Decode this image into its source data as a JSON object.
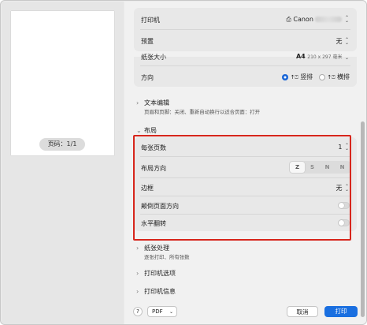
{
  "preview": {
    "page_badge": "页码：1/1"
  },
  "printer_card": {
    "printer_label": "打印机",
    "printer_value": "Canon",
    "preset_label": "预置",
    "preset_value": "无"
  },
  "paper": {
    "size_label": "纸张大小",
    "size_value": "A4",
    "size_detail": "210 x 297 毫米",
    "orientation_label": "方向",
    "portrait_label": "竖排",
    "landscape_label": "横排"
  },
  "text_edit": {
    "title": "文本编辑",
    "subtitle": "页眉和页脚：关闭、重新自动换行以适合页面：打开"
  },
  "layout": {
    "title": "布局",
    "pages_per_sheet_label": "每张页数",
    "pages_per_sheet_value": "1",
    "layout_direction_label": "布局方向",
    "layout_direction_options": [
      "Z",
      "S",
      "N",
      "N"
    ],
    "border_label": "边框",
    "border_value": "无",
    "reverse_orientation_label": "颠倒页面方向",
    "flip_horizontal_label": "水平翻转"
  },
  "paper_handling": {
    "title": "纸张处理",
    "subtitle": "逐张打印、所有张数"
  },
  "printer_options": {
    "title": "打印机选项"
  },
  "printer_info": {
    "title": "打印机信息"
  },
  "footer": {
    "help": "?",
    "pdf": "PDF",
    "cancel": "取消",
    "print": "打印"
  },
  "icons": [
    "printer-icon",
    "chevron-right-icon",
    "chevron-down-icon",
    "stepper-icon",
    "portrait-icon",
    "landscape-icon",
    "help-icon"
  ],
  "colors": {
    "accent": "#1a6fe0",
    "highlight": "#d7261c"
  }
}
